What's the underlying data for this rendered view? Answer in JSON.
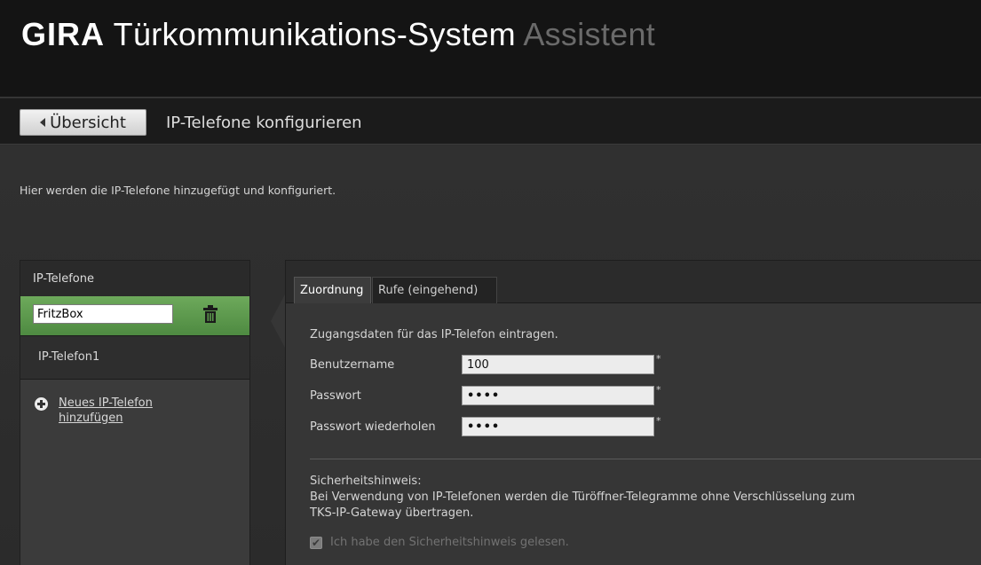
{
  "header": {
    "brand": "GIRA",
    "product": "Türkommunikations-System",
    "subtitle": "Assistent"
  },
  "nav": {
    "back_label": "Übersicht",
    "page_title": "IP-Telefone konfigurieren"
  },
  "intro_text": "Hier werden die IP-Telefone hinzugefügt und konfiguriert.",
  "sidebar": {
    "heading": "IP-Telefone",
    "active_item_name": "FritzBox",
    "items": [
      {
        "label": "IP-Telefon1"
      }
    ],
    "add_label": "Neues IP-Telefon hinzufügen"
  },
  "tabs": [
    {
      "label": "Zuordnung",
      "active": true
    },
    {
      "label": "Rufe (eingehend)",
      "active": false
    }
  ],
  "form": {
    "intro": "Zugangsdaten für das IP-Telefon eintragen.",
    "username_label": "Benutzername",
    "username_value": "100",
    "password_label": "Passwort",
    "password_value": "••••",
    "password_repeat_label": "Passwort wiederholen",
    "password_repeat_value": "••••",
    "required_mark": "*"
  },
  "security": {
    "title": "Sicherheitshinweis:",
    "line1": "Bei Verwendung von IP-Telefonen werden die Türöffner-Telegramme ohne Verschlüsselung zum",
    "line2": "TKS-IP-Gateway übertragen.",
    "ack_label": "Ich habe den Sicherheitshinweis gelesen.",
    "ack_checked": true
  },
  "colors": {
    "accent_green": "#5e9a4e",
    "background": "#2e2e2e",
    "header_bg": "#141414"
  }
}
